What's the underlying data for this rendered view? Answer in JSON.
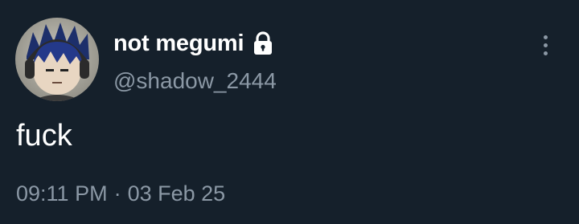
{
  "user": {
    "display_name": "not megumi",
    "handle": "@shadow_2444",
    "protected_icon": "lock-icon",
    "avatar_icon": "avatar-image"
  },
  "tweet": {
    "text": "fuck",
    "time": "09:11 PM",
    "separator": "·",
    "date": "03 Feb 25"
  },
  "actions": {
    "more_icon": "more-vertical-icon"
  },
  "colors": {
    "background": "#15202b",
    "primary_text": "#ffffff",
    "secondary_text": "#8b98a5"
  }
}
